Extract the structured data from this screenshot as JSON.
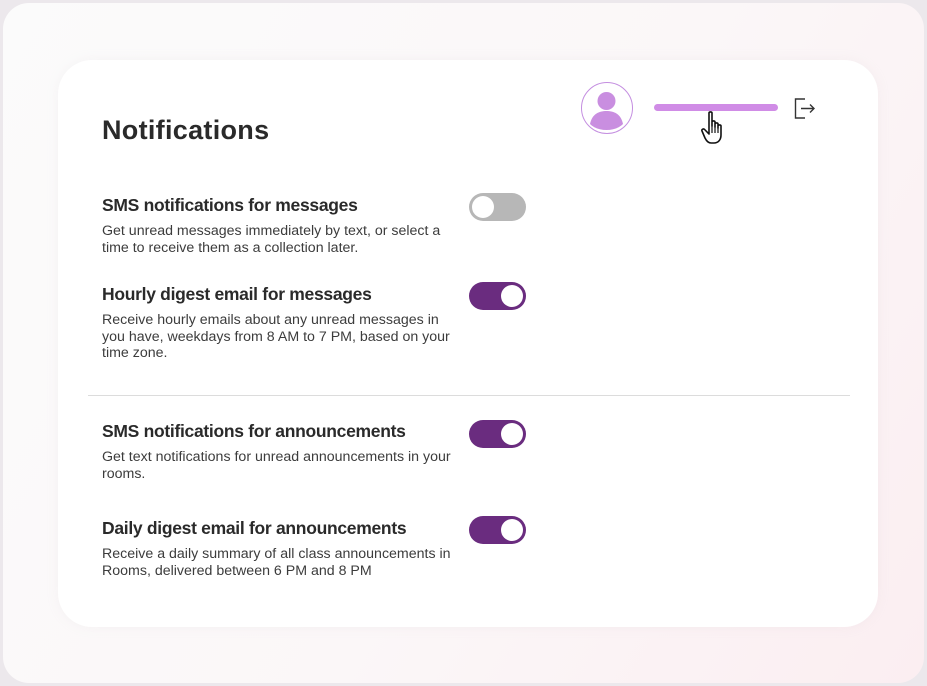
{
  "header": {
    "title": "Notifications",
    "avatar_icon": "user-avatar-icon",
    "logout_icon": "logout-icon",
    "accent_color": "#d08ce6"
  },
  "settings": [
    {
      "title": "SMS notifications for messages",
      "description": "Get unread messages immediately by text, or select a time to receive them as a collection later.",
      "enabled": false
    },
    {
      "title": "Hourly digest email for messages",
      "description": "Receive hourly emails about any unread messages in you have, weekdays from 8 AM to 7 PM, based on your time zone.",
      "enabled": true
    },
    {
      "title": "SMS notifications for announcements",
      "description": "Get text notifications for unread announcements in your rooms.",
      "enabled": true
    },
    {
      "title": "Daily digest email for announcements",
      "description": "Receive a daily summary of all class announcements in Rooms, delivered between 6 PM and 8 PM",
      "enabled": true
    }
  ],
  "colors": {
    "toggle_on": "#6a2c7f",
    "toggle_off": "#b7b7b7"
  }
}
